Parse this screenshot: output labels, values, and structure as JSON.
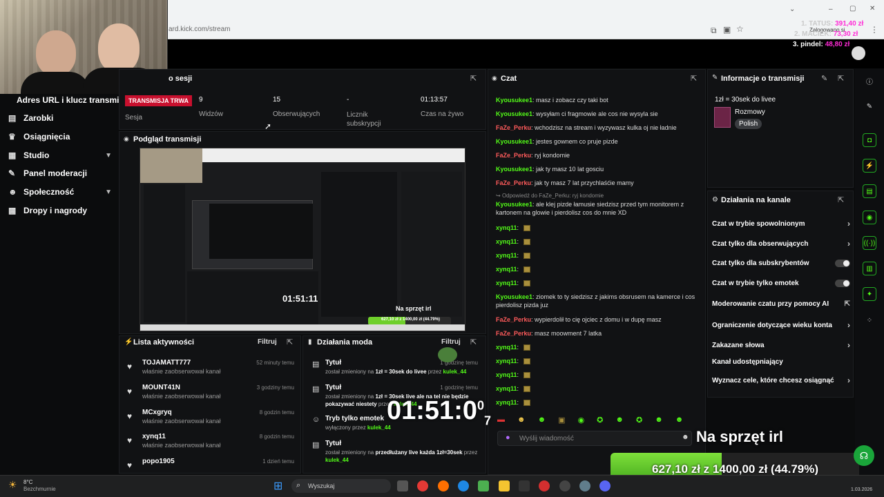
{
  "browser": {
    "url": "ard.kick.com/stream"
  },
  "overlay_top": {
    "line1_label": "1. TATUS:",
    "line1_value": "391,40 zł",
    "line2_label": "2. MACIEK:",
    "line2_value": "73,30 zł",
    "line3_label": "3. pindel:",
    "line3_value": "48,80 zł",
    "logged_in": "Zalogowano si"
  },
  "sidebar": {
    "header": "Adres URL i klucz transmisji",
    "items": [
      {
        "label": "Zarobki",
        "icon": "dollar-icon"
      },
      {
        "label": "Osiągnięcia",
        "icon": "trophy-icon"
      },
      {
        "label": "Studio",
        "icon": "studio-icon"
      },
      {
        "label": "Panel moderacji",
        "icon": "wrench-icon"
      },
      {
        "label": "Społeczność",
        "icon": "people-icon"
      },
      {
        "label": "Dropy i nagrody",
        "icon": "gift-icon"
      }
    ]
  },
  "session": {
    "title": "o sesji",
    "badge": "TRANSMISJA TRWA",
    "sesja": "Sesja",
    "stats": [
      {
        "value": "9",
        "label": "Widzów"
      },
      {
        "value": "15",
        "label": "Obserwujących"
      },
      {
        "value": "-",
        "label": "Licznik subskrypcji"
      },
      {
        "value": "01:13:57",
        "label": "Czas na żywo"
      }
    ]
  },
  "preview": {
    "title": "Podgląd transmisji",
    "mini_timer": "01:51:11",
    "mini_goal_label": "Na sprzęt irl",
    "mini_goal": "627,10 zł z 1400,00 zł (44.79%)"
  },
  "activity": {
    "title": "Lista aktywności",
    "filter": "Filtruj",
    "items": [
      {
        "name": "TOJAMATT777",
        "desc": "właśnie zaobserwował kanał",
        "time": "52 minuty temu"
      },
      {
        "name": "MOUNT41N",
        "desc": "właśnie zaobserwował kanał",
        "time": "3 godziny temu"
      },
      {
        "name": "MCxgryq",
        "desc": "właśnie zaobserwował kanał",
        "time": "8 godzin temu"
      },
      {
        "name": "xynq11",
        "desc": "właśnie zaobserwował kanał",
        "time": "8 godzin temu"
      },
      {
        "name": "popo1905",
        "desc": "",
        "time": "1 dzień temu"
      }
    ]
  },
  "mod_actions": {
    "title": "Działania moda",
    "filter": "Filtruj",
    "items": [
      {
        "title": "Tytuł",
        "desc_a": "został zmieniony na ",
        "desc_b": "1zł = 30sek do livee",
        "desc_c": " przez ",
        "user": "kulek_44",
        "time": "1 godzinę temu"
      },
      {
        "title": "Tytuł",
        "desc_a": "został zmieniony na ",
        "desc_b": "1zł = 30sek live ale na tel nie będzie pokazywać niestety",
        "desc_c": " przez ",
        "user": "kulek_44",
        "time": "1 godzinę temu"
      },
      {
        "title": "Tryb tylko emotek",
        "desc_a": "wyłączony przez ",
        "desc_b": "",
        "desc_c": "",
        "user": "kulek_44",
        "time": ""
      },
      {
        "title": "Tytuł",
        "desc_a": "został zmieniony na ",
        "desc_b": "przedłużany live każda 1zł=30sek",
        "desc_c": " przez ",
        "user": "kulek_44",
        "time": ""
      }
    ]
  },
  "chat": {
    "title": "Czat",
    "reply_note": "Odpowiedź do FaZe_Perku: ryj kondomie",
    "messages": [
      {
        "user": "Kyousukee1",
        "color": "green",
        "text": "masz i zobacz czy taki bot"
      },
      {
        "user": "Kyousukee1",
        "color": "green",
        "text": "wysyłam ci fragmowie ale cos nie wysyla sie"
      },
      {
        "user": "FaZe_Perku",
        "color": "red",
        "text": "wchodzisz na stream i wyzywasz kulka oj nie ładnie"
      },
      {
        "user": "Kyousukee1",
        "color": "green",
        "text": "jestes gownem co pruje pizde"
      },
      {
        "user": "FaZe_Perku",
        "color": "red",
        "text": "ryj kondomie"
      },
      {
        "user": "Kyousukee1",
        "color": "green",
        "text": "jak ty masz 10 lat gosciu"
      },
      {
        "user": "FaZe_Perku",
        "color": "red",
        "text": "jak ty masz 7 lat przychlaśćie mamy"
      }
    ],
    "long_msg": {
      "user": "Kyousukee1",
      "text": "ale klej pizde łamusie siedzisz przed tym monitorem z kartonem na glowie i pierdolisz cos do mnie XD"
    },
    "xynq_user": "xynq11",
    "msg2": {
      "user": "Kyousukee1",
      "text": "ziomek to ty siedzisz z jakims obsrusem na kamerce i cos pierdolisz pizda juz"
    },
    "msg3": {
      "user": "FaZe_Perku",
      "text": "wypierdolił to cię ojciec z domu i w dupę masz"
    },
    "msg4": {
      "user": "FaZe_Perku",
      "text": "masz moowment 7 latka"
    },
    "input_placeholder": "Wyślij wiadomość"
  },
  "stream_info": {
    "title": "Informacje o transmisji",
    "stream_title": "1zł = 30sek do livee",
    "category": "Rozmowy",
    "language": "Polish"
  },
  "channel_actions": {
    "title": "Działania na kanale",
    "items": [
      {
        "label": "Czat w trybie spowolnionym",
        "control": "arrow"
      },
      {
        "label": "Czat tylko dla obserwujących",
        "control": "arrow"
      },
      {
        "label": "Czat tylko dla subskrybentów",
        "control": "toggle"
      },
      {
        "label": "Czat w trybie tylko emotek",
        "control": "toggle"
      },
      {
        "label": "Moderowanie czatu przy pomocy AI",
        "control": "external"
      },
      {
        "label": "Ograniczenie dotyczące wieku konta",
        "control": "arrow"
      },
      {
        "label": "Zakazane słowa",
        "control": "arrow"
      },
      {
        "label": "Kanał udostępniający",
        "control": "none"
      },
      {
        "label": "Wyznacz cele, które chcesz osiągnąć",
        "control": "arrow"
      }
    ]
  },
  "overlay": {
    "timer": "01:51:0",
    "timer_sup": "0",
    "timer_sub": "7",
    "goal_label": "Na sprzęt irl",
    "goal_current": "627,10 zł",
    "goal_sep": " z ",
    "goal_target": "1400,00 zł",
    "goal_percent": "(44.79%)",
    "goal_progress": 0.4479
  },
  "taskbar": {
    "weather_temp": "8°C",
    "weather_desc": "Bezchmurnie",
    "search_placeholder": "Wyszukaj",
    "date": "1.03.2026"
  },
  "colors": {
    "kick_green": "#53fc18",
    "live_red": "#c8102e",
    "chat_red": "#ff5b5b",
    "bg": "#0b0c0d"
  }
}
